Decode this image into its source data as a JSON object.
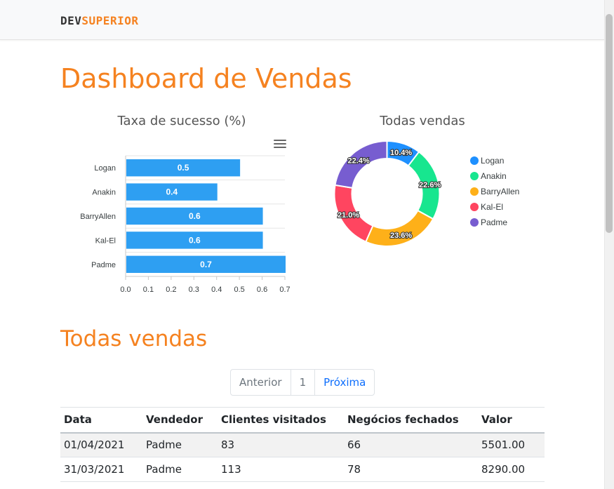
{
  "brand": {
    "part1": "DEV",
    "part2": "SUPERIOR"
  },
  "page_title": "Dashboard de Vendas",
  "colors": {
    "accent": "#f58220",
    "bar": "#2e9ff2",
    "link": "#0d6efd"
  },
  "icons": {
    "chart_menu": "hamburger-menu-icon"
  },
  "bar_chart": {
    "title": "Taxa de sucesso (%)",
    "categories": [
      "Logan",
      "Anakin",
      "BarryAllen",
      "Kal-El",
      "Padme"
    ],
    "values": [
      0.5,
      0.4,
      0.6,
      0.6,
      0.7
    ],
    "value_labels": [
      "0.5",
      "0.4",
      "0.6",
      "0.6",
      "0.7"
    ],
    "ticks": [
      "0.0",
      "0.1",
      "0.2",
      "0.3",
      "0.4",
      "0.5",
      "0.6",
      "0.7"
    ]
  },
  "donut_chart": {
    "title": "Todas vendas",
    "labels": [
      "Logan",
      "Anakin",
      "BarryAllen",
      "Kal-El",
      "Padme"
    ],
    "percent_labels": [
      "10.4%",
      "22.6%",
      "23.6%",
      "21.0%",
      "22.4%"
    ],
    "colors": [
      "#1e90ff",
      "#17e68f",
      "#feb019",
      "#ff4560",
      "#775dd0"
    ]
  },
  "chart_data": [
    {
      "type": "bar",
      "orientation": "horizontal",
      "title": "Taxa de sucesso (%)",
      "categories": [
        "Logan",
        "Anakin",
        "BarryAllen",
        "Kal-El",
        "Padme"
      ],
      "values": [
        0.5,
        0.4,
        0.6,
        0.6,
        0.7
      ],
      "xlim": [
        0,
        0.7
      ],
      "grid": true
    },
    {
      "type": "pie",
      "donut": true,
      "title": "Todas vendas",
      "labels": [
        "Logan",
        "Anakin",
        "BarryAllen",
        "Kal-El",
        "Padme"
      ],
      "values": [
        10.4,
        22.6,
        23.6,
        21.0,
        22.4
      ],
      "legend": "right"
    }
  ],
  "sales_section_title": "Todas vendas",
  "pagination": {
    "prev": "Anterior",
    "current": "1",
    "next": "Próxima"
  },
  "table": {
    "headers": [
      "Data",
      "Vendedor",
      "Clientes visitados",
      "Negócios fechados",
      "Valor"
    ],
    "rows": [
      [
        "01/04/2021",
        "Padme",
        "83",
        "66",
        "5501.00"
      ],
      [
        "31/03/2021",
        "Padme",
        "113",
        "78",
        "8290.00"
      ]
    ]
  }
}
